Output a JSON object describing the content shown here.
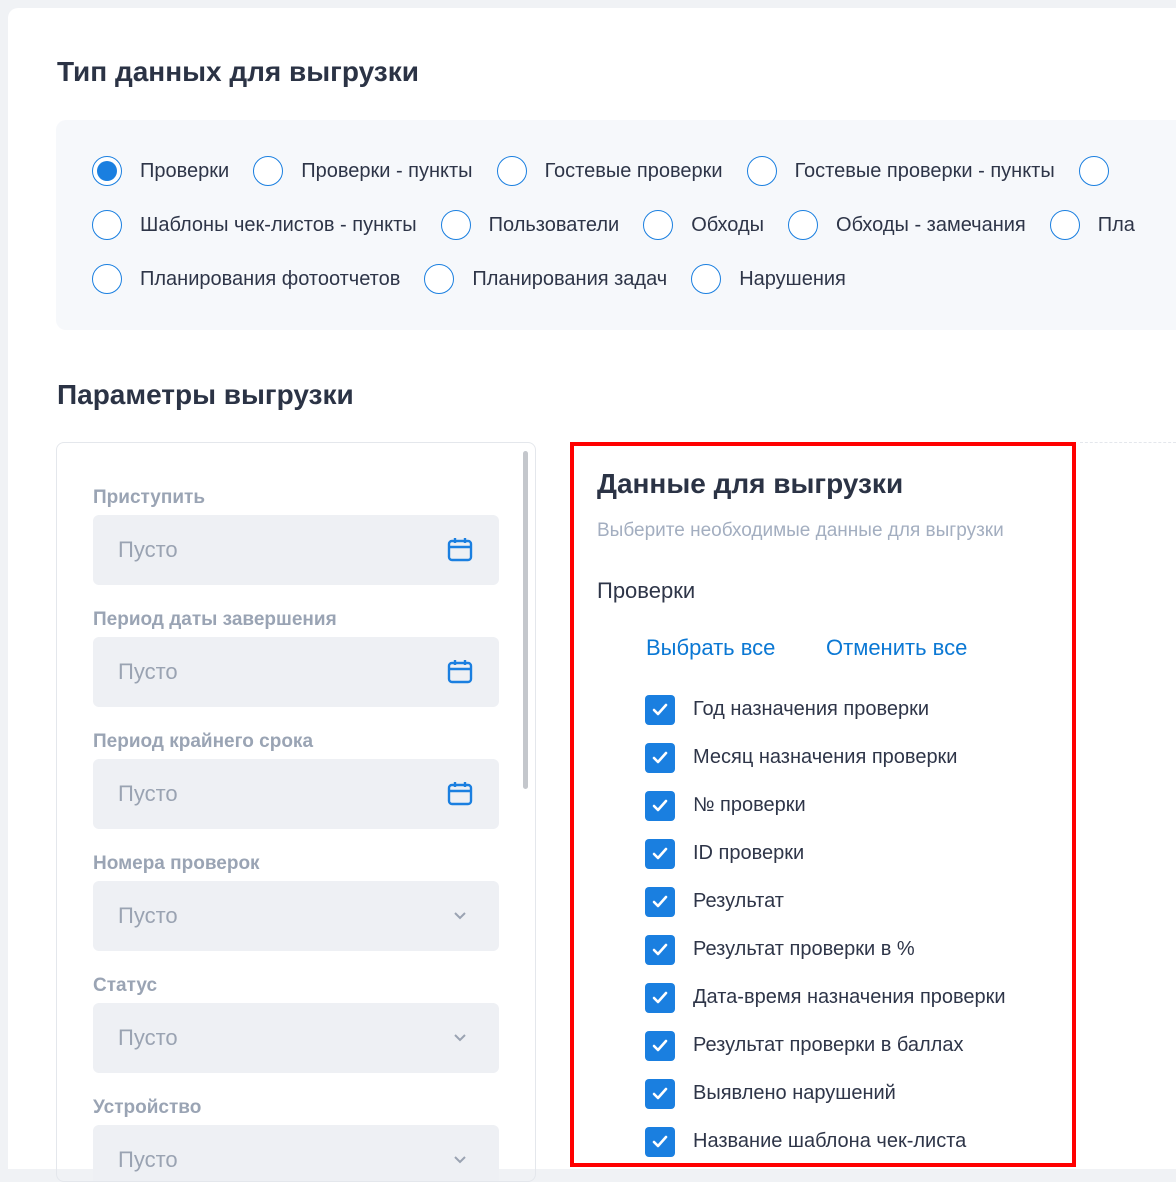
{
  "section_type_title": "Тип данных для выгрузки",
  "data_types": {
    "rows": [
      [
        {
          "label": "Проверки",
          "selected": true
        },
        {
          "label": "Проверки - пункты"
        },
        {
          "label": "Гостевые проверки"
        },
        {
          "label": "Гостевые проверки - пункты"
        },
        {
          "label": ""
        }
      ],
      [
        {
          "label": "Шаблоны чек-листов - пункты"
        },
        {
          "label": "Пользователи"
        },
        {
          "label": "Обходы"
        },
        {
          "label": "Обходы - замечания"
        },
        {
          "label": "Пла"
        }
      ],
      [
        {
          "label": "Планирования фотоотчетов"
        },
        {
          "label": "Планирования задач"
        },
        {
          "label": "Нарушения"
        }
      ]
    ]
  },
  "section_params_title": "Параметры выгрузки",
  "filters": [
    {
      "label": "Приступить",
      "placeholder": "Пусто",
      "icon": "calendar-icon"
    },
    {
      "label": "Период даты завершения",
      "placeholder": "Пусто",
      "icon": "calendar-icon"
    },
    {
      "label": "Период крайнего срока",
      "placeholder": "Пусто",
      "icon": "calendar-icon"
    },
    {
      "label": "Номера проверок",
      "placeholder": "Пусто",
      "icon": "chevron-down-icon"
    },
    {
      "label": "Статус",
      "placeholder": "Пусто",
      "icon": "chevron-down-icon"
    },
    {
      "label": "Устройство",
      "placeholder": "Пусто",
      "icon": "chevron-down-icon"
    }
  ],
  "export_data": {
    "title": "Данные для выгрузки",
    "subtitle": "Выберите необходимые данные для выгрузки",
    "group": "Проверки",
    "select_all": "Выбрать все",
    "deselect_all": "Отменить все",
    "fields": [
      {
        "label": "Год назначения проверки",
        "checked": true
      },
      {
        "label": "Месяц назначения проверки",
        "checked": true
      },
      {
        "label": "№ проверки",
        "checked": true
      },
      {
        "label": "ID проверки",
        "checked": true
      },
      {
        "label": "Результат",
        "checked": true
      },
      {
        "label": "Результат проверки в %",
        "checked": true
      },
      {
        "label": "Дата-время назначения проверки",
        "checked": true
      },
      {
        "label": "Результат проверки в баллах",
        "checked": true
      },
      {
        "label": "Выявлено нарушений",
        "checked": true
      },
      {
        "label": "Название шаблона чек-листа",
        "checked": true
      }
    ]
  },
  "colors": {
    "accent": "#1a7fe0",
    "highlight": "#ff0000"
  }
}
